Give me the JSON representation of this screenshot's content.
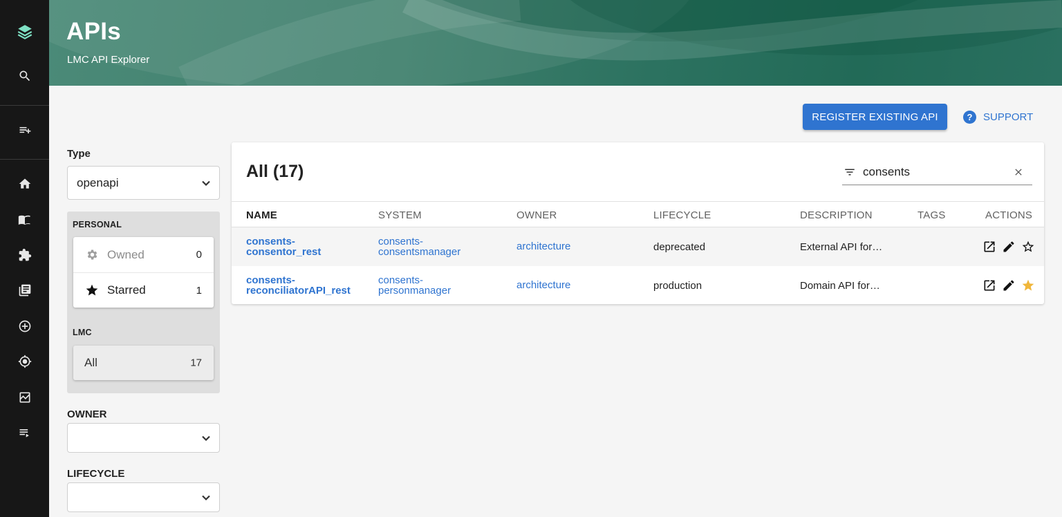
{
  "sidebar": {
    "items": [
      {
        "icon": "logo-icon"
      },
      {
        "icon": "search-icon"
      },
      {
        "icon": "playlist-add-icon"
      },
      {
        "icon": "home-icon"
      },
      {
        "icon": "book-icon"
      },
      {
        "icon": "puzzle-icon"
      },
      {
        "icon": "library-icon"
      },
      {
        "icon": "add-circle-icon"
      },
      {
        "icon": "target-icon"
      },
      {
        "icon": "image-chart-icon"
      },
      {
        "icon": "queue-icon"
      }
    ]
  },
  "header": {
    "title": "APIs",
    "subtitle": "LMC API Explorer"
  },
  "actions": {
    "register_label": "REGISTER EXISTING API",
    "support_label": "SUPPORT"
  },
  "filters": {
    "type_label": "Type",
    "type_value": "openapi",
    "personal_title": "PERSONAL",
    "owned": {
      "label": "Owned",
      "count": "0"
    },
    "starred": {
      "label": "Starred",
      "count": "1"
    },
    "org_title": "LMC",
    "all": {
      "label": "All",
      "count": "17"
    },
    "owner_label": "OWNER",
    "owner_value": "",
    "lifecycle_label": "LIFECYCLE",
    "lifecycle_value": ""
  },
  "table": {
    "title": "All (17)",
    "search_value": "consents",
    "columns": [
      "NAME",
      "SYSTEM",
      "OWNER",
      "LIFECYCLE",
      "DESCRIPTION",
      "TAGS",
      "ACTIONS"
    ],
    "rows": [
      {
        "name_line1": "consents-",
        "name_line2": "consentor_rest",
        "system_line1": "consents-",
        "system_line2": "consentsmanager",
        "owner": "architecture",
        "lifecycle": "deprecated",
        "description": "External API for…",
        "tags": "",
        "starred": false
      },
      {
        "name_line1": "consents-",
        "name_line2": "reconciliatorAPI_rest",
        "system_line1": "consents-",
        "system_line2": "personmanager",
        "owner": "architecture",
        "lifecycle": "production",
        "description": "Domain API for…",
        "tags": "",
        "starred": true
      }
    ]
  },
  "colors": {
    "primary": "#2f74d0",
    "star_filled": "#f0b63a",
    "sidebar_bg": "#171717",
    "header_green": "#2c7260"
  }
}
